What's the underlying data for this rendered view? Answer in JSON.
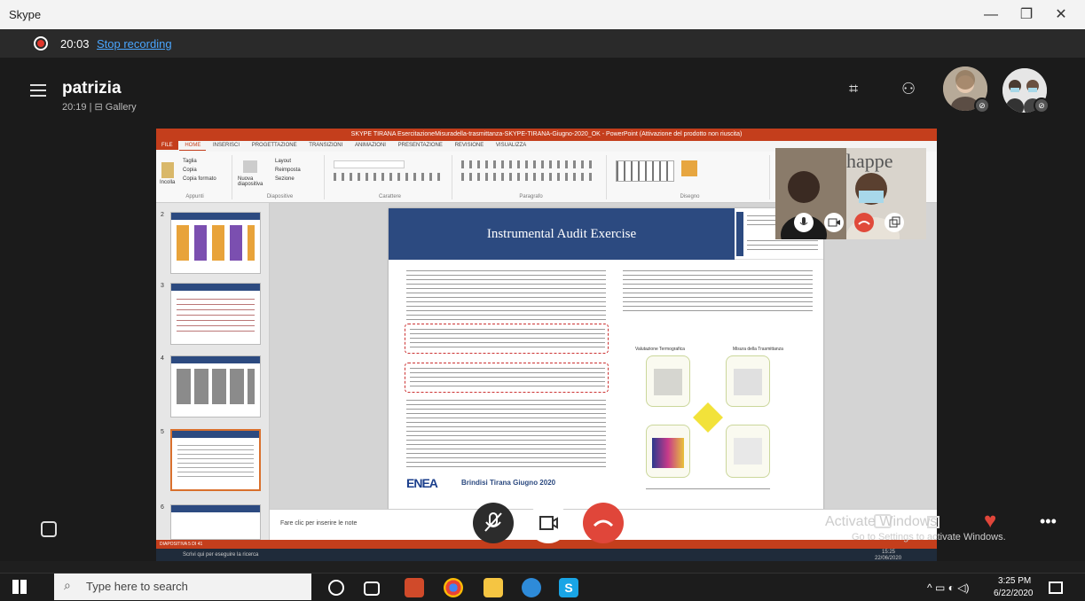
{
  "window": {
    "app_title": "Skype",
    "minimize": "—",
    "restore": "❐",
    "close": "✕"
  },
  "recording": {
    "time": "20:03",
    "stop_label": "Stop recording"
  },
  "call": {
    "name": "patrizia",
    "subtitle": "20:19 | ⊟ Gallery"
  },
  "powerpoint": {
    "title": "SKYPE TIRANA EsercitazioneMisuradella-trasmittanza-SKYPE-TIRANA-Giugno-2020_OK - PowerPoint (Attivazione del prodotto non riuscita)",
    "tabs": [
      "FILE",
      "HOME",
      "INSERISCI",
      "PROGETTAZIONE",
      "TRANSIZIONI",
      "ANIMAZIONI",
      "PRESENTAZIONE",
      "REVISIONE",
      "VISUALIZZA"
    ],
    "ribbon_groups": [
      "Appunti",
      "Diapositive",
      "Carattere",
      "Paragrafo",
      "Disegno"
    ],
    "ribbon_items": {
      "taglia": "Taglia",
      "copia": "Copia",
      "copia_formato": "Copia formato",
      "incolla": "Incolla",
      "nuova": "Nuova diapositiva",
      "layout": "Layout",
      "reimposta": "Reimposta",
      "sezione": "Sezione"
    },
    "thumb_numbers": [
      "2",
      "3",
      "4",
      "5",
      "6"
    ],
    "slide_title": "Instrumental Audit Exercise",
    "slide_footer": "Brindisi  Tirana Giugno 2020",
    "slide_logo": "ENEA",
    "diagram_labels": {
      "left": "Valutazione Termografica",
      "right": "Misura della Trasmittanza"
    },
    "notes_placeholder": "Fare clic per inserire le note",
    "status": "DIAPOSITIVA 5 DI 41",
    "inner_search": "Scrivi qui per eseguire la ricerca",
    "inner_time": "15:25",
    "inner_date": "22/06/2020"
  },
  "watermark": {
    "line1": "Activate Windows",
    "line2": "Go to Settings to activate Windows."
  },
  "taskbar": {
    "search_placeholder": "Type here to search",
    "time": "3:25 PM",
    "date": "6/22/2020"
  }
}
